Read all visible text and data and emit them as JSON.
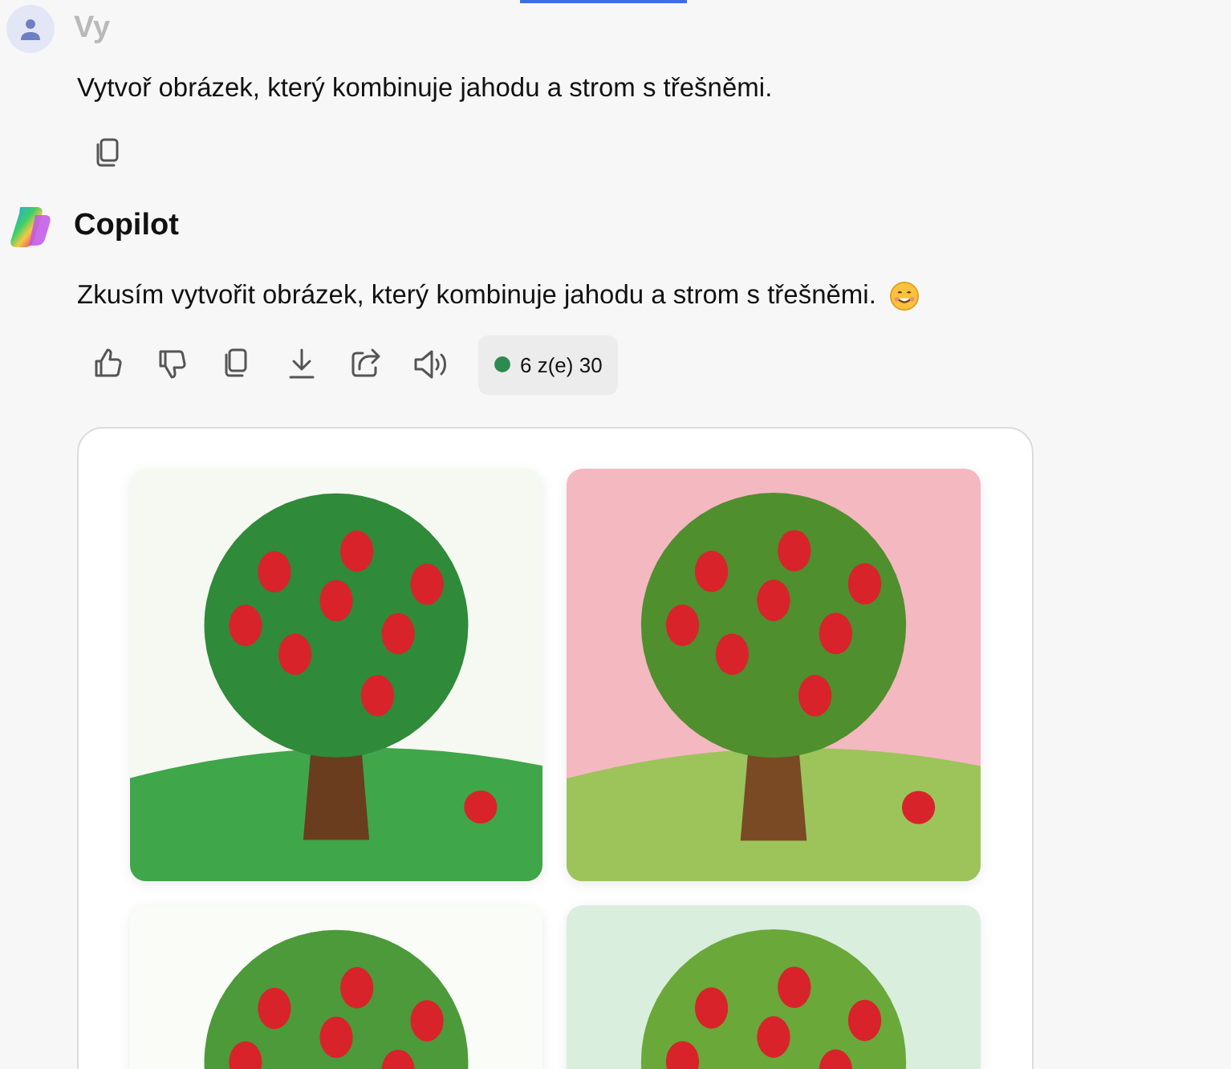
{
  "user_message": {
    "author": "Vy",
    "text": "Vytvoř obrázek, který kombinuje jahodu a strom s třešněmi.",
    "actions": [
      {
        "kind": "copy"
      }
    ]
  },
  "assistant_message": {
    "author": "Copilot",
    "text": "Zkusím vytvořit obrázek, který kombinuje jahodu a strom s třešněmi.",
    "actions": [
      {
        "kind": "like"
      },
      {
        "kind": "dislike"
      },
      {
        "kind": "copy"
      },
      {
        "kind": "download"
      },
      {
        "kind": "share"
      },
      {
        "kind": "speak"
      }
    ],
    "counter": {
      "text": "6 z(e) 30",
      "color": "#2e8b4f"
    }
  }
}
